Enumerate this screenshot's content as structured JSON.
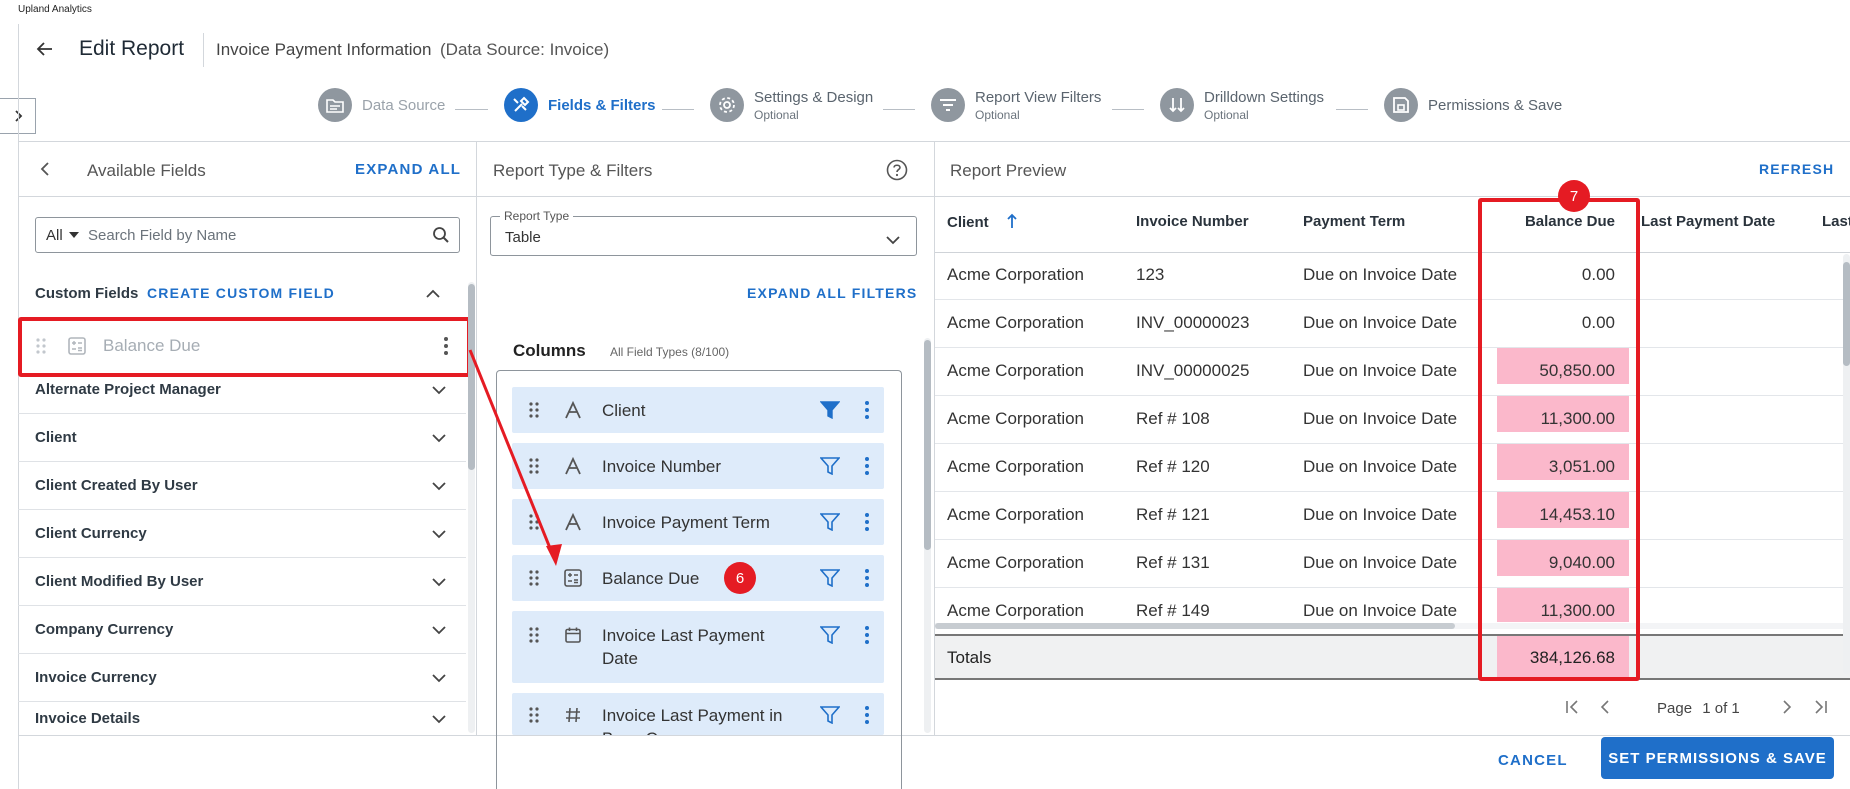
{
  "brand": "Upland Analytics",
  "header": {
    "title": "Edit Report",
    "report_name": "Invoice Payment Information",
    "data_source_note": "(Data Source: Invoice)"
  },
  "steps": [
    {
      "label": "Data Source",
      "sub": ""
    },
    {
      "label": "Fields & Filters",
      "sub": ""
    },
    {
      "label": "Settings & Design",
      "sub": "Optional"
    },
    {
      "label": "Report View Filters",
      "sub": "Optional"
    },
    {
      "label": "Drilldown Settings",
      "sub": "Optional"
    },
    {
      "label": "Permissions & Save",
      "sub": ""
    }
  ],
  "left_panel": {
    "title": "Available Fields",
    "expand_all": "EXPAND ALL",
    "filter_value": "All",
    "search_placeholder": "Search Field by Name",
    "custom_fields_label": "Custom Fields",
    "create_custom_field": "CREATE CUSTOM FIELD",
    "dragged_field": "Balance Due",
    "groups": [
      "Alternate Project Manager",
      "Client",
      "Client Created By User",
      "Client Currency",
      "Client Modified By User",
      "Company Currency",
      "Invoice Currency",
      "Invoice Details"
    ]
  },
  "middle_panel": {
    "title": "Report Type & Filters",
    "report_type_label": "Report Type",
    "report_type_value": "Table",
    "expand_all_filters": "EXPAND ALL FILTERS",
    "columns_title": "Columns",
    "columns_sub": "All Field Types (8/100)",
    "columns": [
      {
        "label": "Client",
        "type_icon": "text-type-icon"
      },
      {
        "label": "Invoice Number",
        "type_icon": "text-type-icon"
      },
      {
        "label": "Invoice Payment Term",
        "type_icon": "text-type-icon"
      },
      {
        "label": "Balance Due",
        "type_icon": "calculator-icon"
      },
      {
        "label": "Invoice Last Payment Date",
        "type_icon": "calendar-icon"
      },
      {
        "label": "Invoice Last Payment in Base C",
        "type_icon": "hash-icon"
      }
    ]
  },
  "right_panel": {
    "title": "Report Preview",
    "refresh": "REFRESH",
    "headers": [
      "Client",
      "Invoice Number",
      "Payment Term",
      "Balance Due",
      "Last Payment Date",
      "Last"
    ],
    "rows": [
      [
        "Acme Corporation",
        "123",
        "Due on Invoice Date",
        "0.00"
      ],
      [
        "Acme Corporation",
        "INV_00000023",
        "Due on Invoice Date",
        "0.00"
      ],
      [
        "Acme Corporation",
        "INV_00000025",
        "Due on Invoice Date",
        "50,850.00"
      ],
      [
        "Acme Corporation",
        "Ref # 108",
        "Due on Invoice Date",
        "11,300.00"
      ],
      [
        "Acme Corporation",
        "Ref # 120",
        "Due on Invoice Date",
        "3,051.00"
      ],
      [
        "Acme Corporation",
        "Ref # 121",
        "Due on Invoice Date",
        "14,453.10"
      ],
      [
        "Acme Corporation",
        "Ref # 131",
        "Due on Invoice Date",
        "9,040.00"
      ],
      [
        "Acme Corporation",
        "Ref # 149",
        "Due on Invoice Date",
        "11,300.00"
      ]
    ],
    "totals_label": "Totals",
    "totals_value": "384,126.68",
    "page_label": "Page",
    "page_value": "1 of 1"
  },
  "annotations": {
    "badge_6": "6",
    "badge_7": "7"
  },
  "footer": {
    "cancel": "CANCEL",
    "save": "SET PERMISSIONS & SAVE"
  },
  "colors": {
    "accent": "#1f6fc9",
    "highlight": "#fbb8cb",
    "annotation": "#e51b23"
  }
}
